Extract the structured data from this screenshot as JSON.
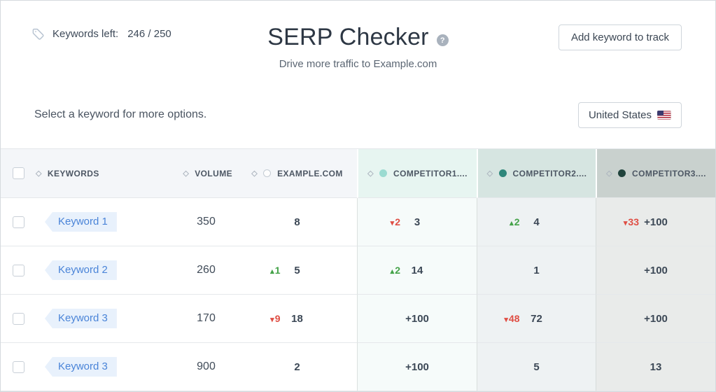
{
  "header": {
    "keywords_left_label": "Keywords left:",
    "keywords_left_value": "246 / 250",
    "title": "SERP Checker",
    "help_glyph": "?",
    "subtitle": "Drive more traffic to Example.com",
    "add_button": "Add keyword to track",
    "select_hint": "Select a keyword for more options.",
    "country": "United States"
  },
  "icons": {
    "sort": "◇",
    "up": "▴",
    "down": "▾",
    "tag": "tag-outline-icon",
    "flag": "us-flag-icon"
  },
  "colors": {
    "accent_blue": "#4a84d8",
    "up_green": "#44a248",
    "down_red": "#df4e44",
    "competitor1_dot": "#9bdbd1",
    "competitor2_dot": "#2f877b",
    "competitor3_dot": "#21443d"
  },
  "table": {
    "columns": [
      {
        "id": "keywords",
        "label": "KEYWORDS"
      },
      {
        "id": "volume",
        "label": "VOLUME"
      },
      {
        "id": "example",
        "label": "EXAMPLE.COM",
        "marker": "open-circle"
      },
      {
        "id": "competitor1",
        "label": "COMPETITOR1....",
        "marker": "dot",
        "dot_color": "#9bdbd1"
      },
      {
        "id": "competitor2",
        "label": "COMPETITOR2....",
        "marker": "dot",
        "dot_color": "#2f877b"
      },
      {
        "id": "competitor3",
        "label": "COMPETITOR3....",
        "marker": "dot",
        "dot_color": "#21443d"
      }
    ],
    "rows": [
      {
        "keyword": "Keyword 1",
        "volume": "350",
        "ranks": {
          "example": {
            "dir": null,
            "delta": null,
            "value": "8"
          },
          "competitor1": {
            "dir": "down",
            "delta": "2",
            "value": "3"
          },
          "competitor2": {
            "dir": "up",
            "delta": "2",
            "value": "4"
          },
          "competitor3": {
            "dir": "down",
            "delta": "33",
            "value": "+100"
          }
        }
      },
      {
        "keyword": "Keyword 2",
        "volume": "260",
        "ranks": {
          "example": {
            "dir": "up",
            "delta": "1",
            "value": "5"
          },
          "competitor1": {
            "dir": "up",
            "delta": "2",
            "value": "14"
          },
          "competitor2": {
            "dir": null,
            "delta": null,
            "value": "1"
          },
          "competitor3": {
            "dir": null,
            "delta": null,
            "value": "+100"
          }
        }
      },
      {
        "keyword": "Keyword 3",
        "volume": "170",
        "ranks": {
          "example": {
            "dir": "down",
            "delta": "9",
            "value": "18"
          },
          "competitor1": {
            "dir": null,
            "delta": null,
            "value": "+100"
          },
          "competitor2": {
            "dir": "down",
            "delta": "48",
            "value": "72"
          },
          "competitor3": {
            "dir": null,
            "delta": null,
            "value": "+100"
          }
        }
      },
      {
        "keyword": "Keyword 3",
        "volume": "900",
        "ranks": {
          "example": {
            "dir": null,
            "delta": null,
            "value": "2"
          },
          "competitor1": {
            "dir": null,
            "delta": null,
            "value": "+100"
          },
          "competitor2": {
            "dir": null,
            "delta": null,
            "value": "5"
          },
          "competitor3": {
            "dir": null,
            "delta": null,
            "value": "13"
          }
        }
      }
    ]
  }
}
